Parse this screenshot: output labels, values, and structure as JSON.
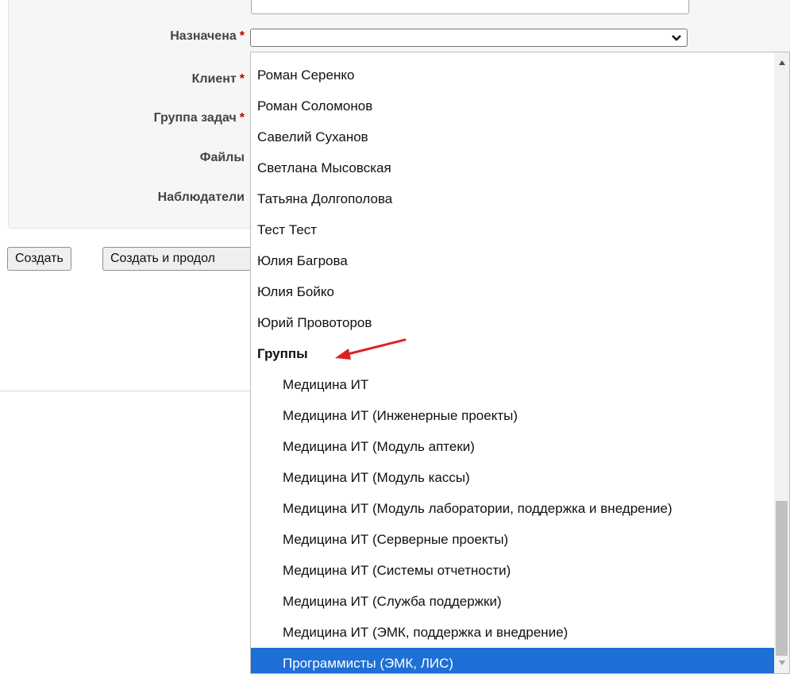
{
  "form": {
    "assigned": {
      "label": "Назначена",
      "required_mark": "*",
      "value": ""
    },
    "client": {
      "label": "Клиент",
      "required_mark": "*"
    },
    "task_group": {
      "label": "Группа задач",
      "required_mark": "*"
    },
    "files": {
      "label": "Файлы"
    },
    "watchers": {
      "label": "Наблюдатели"
    }
  },
  "buttons": {
    "create": "Создать",
    "create_continue": "Создать и продол"
  },
  "dropdown": {
    "options": [
      {
        "label": "Роман Серенко",
        "kind": "user"
      },
      {
        "label": "Роман Соломонов",
        "kind": "user"
      },
      {
        "label": "Савелий Суханов",
        "kind": "user"
      },
      {
        "label": "Светлана Мысовская",
        "kind": "user"
      },
      {
        "label": "Татьяна Долгополова",
        "kind": "user"
      },
      {
        "label": "Тест Тест",
        "kind": "user"
      },
      {
        "label": "Юлия Багрова",
        "kind": "user"
      },
      {
        "label": "Юлия Бойко",
        "kind": "user"
      },
      {
        "label": "Юрий Провоторов",
        "kind": "user"
      },
      {
        "label": "Группы",
        "kind": "group"
      },
      {
        "label": "Медицина ИТ",
        "kind": "sub"
      },
      {
        "label": "Медицина ИТ (Инженерные проекты)",
        "kind": "sub"
      },
      {
        "label": "Медицина ИТ (Модуль аптеки)",
        "kind": "sub"
      },
      {
        "label": "Медицина ИТ (Модуль кассы)",
        "kind": "sub"
      },
      {
        "label": "Медицина ИТ (Модуль лаборатории, поддержка и внедрение)",
        "kind": "sub"
      },
      {
        "label": "Медицина ИТ (Серверные проекты)",
        "kind": "sub"
      },
      {
        "label": "Медицина ИТ (Системы отчетности)",
        "kind": "sub"
      },
      {
        "label": "Медицина ИТ (Служба поддержки)",
        "kind": "sub"
      },
      {
        "label": "Медицина ИТ (ЭМК, поддержка и внедрение)",
        "kind": "sub"
      },
      {
        "label": "Программисты (ЭМК, ЛИС)",
        "kind": "sub",
        "selected": true
      }
    ]
  },
  "colors": {
    "selection": "#1e6fd6",
    "required": "#bb0000",
    "annotation_arrow": "#e02020"
  },
  "icons": {
    "select_toggle": "chevron-down-icon",
    "annotation": "red-arrow-icon"
  }
}
